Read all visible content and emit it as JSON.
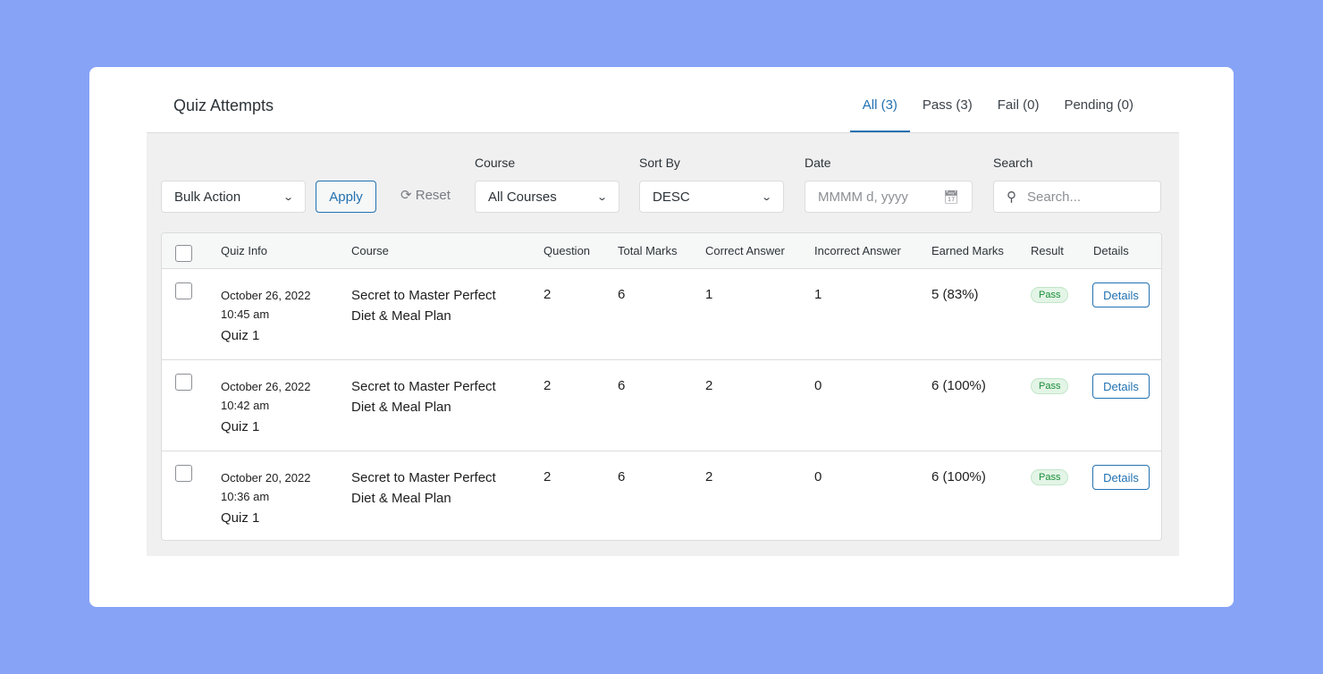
{
  "header": {
    "title": "Quiz Attempts"
  },
  "tabs": [
    {
      "label": "All (3)"
    },
    {
      "label": "Pass (3)"
    },
    {
      "label": "Fail (0)"
    },
    {
      "label": "Pending (0)"
    }
  ],
  "filters": {
    "bulk_action": "Bulk Action",
    "apply": "Apply",
    "reset": "Reset",
    "course_label": "Course",
    "course_value": "All Courses",
    "sort_label": "Sort By",
    "sort_value": "DESC",
    "date_label": "Date",
    "date_placeholder": "MMMM d, yyyy",
    "search_label": "Search",
    "search_placeholder": "Search..."
  },
  "columns": [
    "Quiz Info",
    "Course",
    "Question",
    "Total Marks",
    "Correct Answer",
    "Incorrect Answer",
    "Earned Marks",
    "Result",
    "Details"
  ],
  "rows": [
    {
      "date": "October 26, 2022",
      "time": "10:45 am",
      "quiz": "Quiz 1",
      "course": "Secret to Master Perfect Diet & Meal Plan",
      "question": "2",
      "total": "6",
      "correct": "1",
      "incorrect": "1",
      "earned": "5 (83%)",
      "result": "Pass",
      "details": "Details"
    },
    {
      "date": "October 26, 2022",
      "time": "10:42 am",
      "quiz": "Quiz 1",
      "course": "Secret to Master Perfect Diet & Meal Plan",
      "question": "2",
      "total": "6",
      "correct": "2",
      "incorrect": "0",
      "earned": "6 (100%)",
      "result": "Pass",
      "details": "Details"
    },
    {
      "date": "October 20, 2022",
      "time": "10:36 am",
      "quiz": "Quiz 1",
      "course": "Secret to Master Perfect Diet & Meal Plan",
      "question": "2",
      "total": "6",
      "correct": "2",
      "incorrect": "0",
      "earned": "6 (100%)",
      "result": "Pass",
      "details": "Details"
    }
  ],
  "colors": {
    "accent": "#2271b1",
    "background": "#87a3f6",
    "pass": "#1a8d3a"
  }
}
